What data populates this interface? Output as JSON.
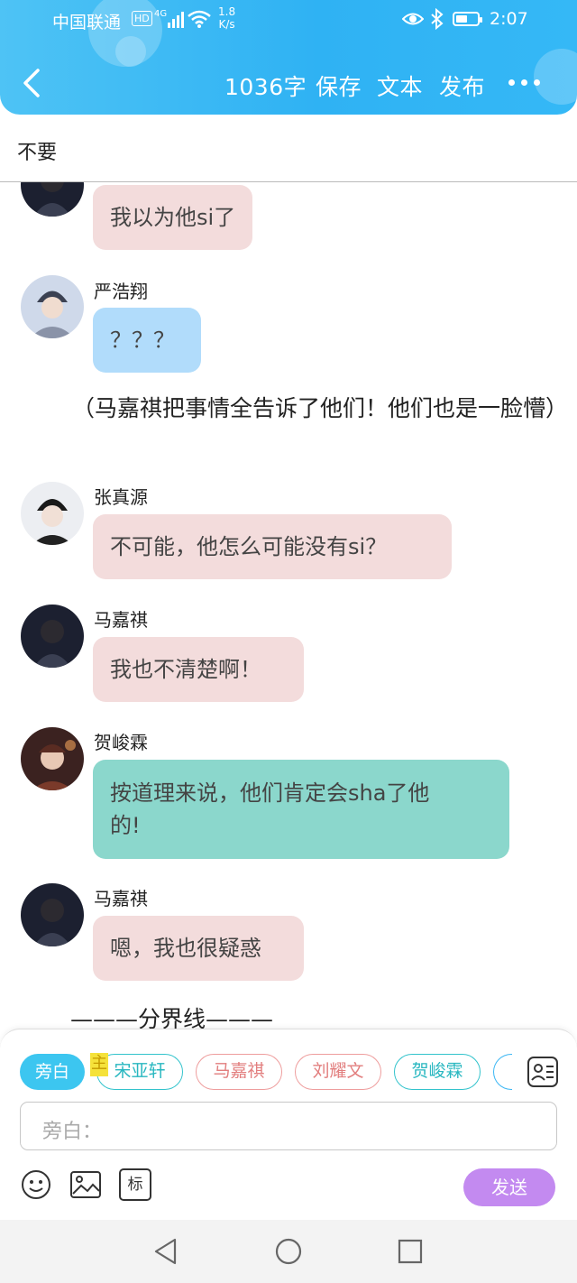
{
  "status_bar": {
    "carrier": "中国联通",
    "hd": "HD",
    "network": "4G",
    "speed_value": "1.8",
    "speed_unit": "K/s",
    "battery_level": 0.55,
    "time": "2:07"
  },
  "header": {
    "word_count": "1036字",
    "save": "保存",
    "text": "文本",
    "publish": "发布"
  },
  "title": "不要",
  "messages": [
    {
      "name": "",
      "text": "我以为他si了",
      "color": "#f3dcdc"
    },
    {
      "name": "严浩翔",
      "text": "？？？",
      "color": "#b1dcfb"
    },
    {
      "narration": "（马嘉祺把事情全告诉了他们！他们也是一脸懵）"
    },
    {
      "name": "张真源",
      "text": "不可能，他怎么可能没有si？",
      "color": "#f3dcdc"
    },
    {
      "name": "马嘉祺",
      "text": "我也不清楚啊！",
      "color": "#f3dcdc"
    },
    {
      "name": "贺峻霖",
      "text_line1": "按道理来说，他们肯定会sha了他",
      "text_line2": "的!",
      "color": "#8bd7cc"
    },
    {
      "name": "马嘉祺",
      "text": "嗯，我也很疑惑",
      "color": "#f3dcdc"
    },
    {
      "divider": "———分界线———"
    }
  ],
  "roles": [
    {
      "label": "旁白",
      "selected": true
    },
    {
      "label": "宋亚轩",
      "badge": "主"
    },
    {
      "label": "马嘉祺"
    },
    {
      "label": "刘耀文"
    },
    {
      "label": "贺峻霖"
    }
  ],
  "input": {
    "placeholder": "旁白："
  },
  "tools": {
    "tag_label": "标"
  },
  "send": "发送",
  "colors": {
    "header_blue": "#2fb2f3",
    "send_purple": "#c38af0",
    "narrator_chip": "#3cc6f0"
  }
}
